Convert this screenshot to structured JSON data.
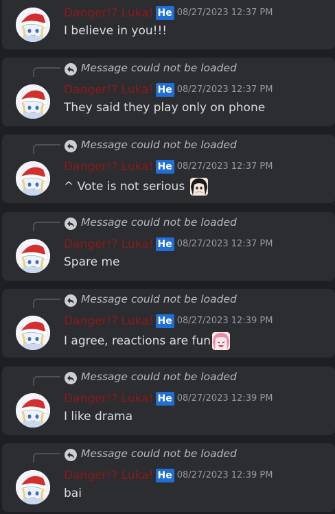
{
  "messages": [
    {
      "reply": "",
      "username": "Danger!? Luka!",
      "tag": "He",
      "timestamp": "08/27/2023 12:37 PM",
      "text": "I believe in you!!!",
      "emoji": ""
    },
    {
      "reply": "Message could not be loaded",
      "username": "Danger!? Luka!",
      "tag": "He",
      "timestamp": "08/27/2023 12:37 PM",
      "text": "They said they play only on phone",
      "emoji": ""
    },
    {
      "reply": "Message could not be loaded",
      "username": "Danger!? Luka!",
      "tag": "He",
      "timestamp": "08/27/2023 12:37 PM",
      "text": "^ Vote is not serious ",
      "emoji": "dark-hair-anime-emoji"
    },
    {
      "reply": "Message could not be loaded",
      "username": "Danger!? Luka!",
      "tag": "He",
      "timestamp": "08/27/2023 12:37 PM",
      "text": "Spare me",
      "emoji": ""
    },
    {
      "reply": "Message could not be loaded",
      "username": "Danger!? Luka!",
      "tag": "He",
      "timestamp": "08/27/2023 12:39 PM",
      "text": "I agree, reactions are fun",
      "emoji": "pink-hair-anime-emoji"
    },
    {
      "reply": "Message could not be loaded",
      "username": "Danger!? Luka!",
      "tag": "He",
      "timestamp": "08/27/2023 12:39 PM",
      "text": "I like drama",
      "emoji": ""
    },
    {
      "reply": "Message could not be loaded",
      "username": "Danger!? Luka!",
      "tag": "He",
      "timestamp": "08/27/2023 12:39 PM",
      "text": "bai",
      "emoji": ""
    }
  ],
  "colors": {
    "background": "#1e1f22",
    "card": "#2b2d31",
    "username": "#8b1a1a",
    "tag": "#1f6fd6",
    "timestamp": "#949ba4",
    "text": "#dbdee1",
    "reply_text": "#b5bac1"
  },
  "icons": {
    "reply": "reply-arrow-icon",
    "avatar": "santa-hat-anime-avatar"
  }
}
